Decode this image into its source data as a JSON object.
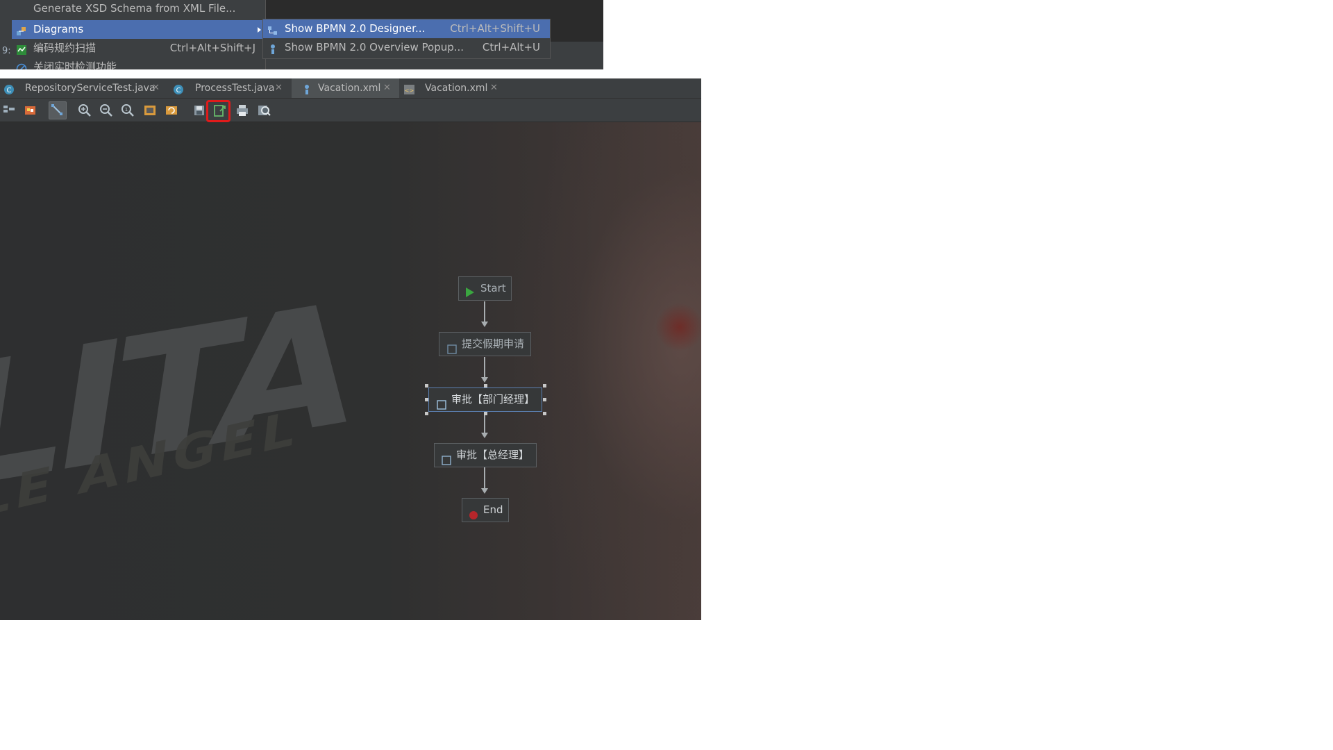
{
  "context_menu": {
    "gutter_char": "9:",
    "items": [
      {
        "label": "Generate XSD Schema from XML File...",
        "shortcut": "",
        "icon": "none"
      },
      {
        "label": "Diagrams",
        "shortcut": "",
        "icon": "diagrams-icon"
      },
      {
        "label": "编码规约扫描",
        "shortcut": "Ctrl+Alt+Shift+J",
        "icon": "scan-icon"
      },
      {
        "label": "关闭实时检测功能",
        "shortcut": "",
        "icon": "disable-icon"
      }
    ],
    "submenu": [
      {
        "label": "Show BPMN 2.0 Designer...",
        "shortcut": "Ctrl+Alt+Shift+U"
      },
      {
        "label": "Show BPMN 2.0 Overview Popup...",
        "shortcut": "Ctrl+Alt+U"
      }
    ]
  },
  "tabs": [
    {
      "label": "RepositoryServiceTest.java",
      "icon": "java-class-icon",
      "active": false
    },
    {
      "label": "ProcessTest.java",
      "icon": "java-class-icon",
      "active": false
    },
    {
      "label": "Vacation.xml",
      "icon": "bpmn-file-icon",
      "active": true
    },
    {
      "label": "Vacation.xml",
      "icon": "xml-file-icon",
      "active": false
    }
  ],
  "toolbar": {
    "buttons": [
      "structure-icon",
      "palette-icon",
      "select-tool-icon",
      "zoom-in-icon",
      "zoom-out-icon",
      "actual-size-icon",
      "fit-content-icon",
      "refresh-layout-icon",
      "save-icon",
      "export-image-icon",
      "print-icon",
      "preview-icon"
    ],
    "highlighted_button": "export-image-icon"
  },
  "background": {
    "title_text": "LITA",
    "subtitle_text": "LE ANGEL"
  },
  "diagram": {
    "nodes": [
      {
        "label": "Start",
        "type": "start-event"
      },
      {
        "label": "提交假期申请",
        "type": "user-task"
      },
      {
        "label": "审批【部门经理】",
        "type": "user-task",
        "selected": true
      },
      {
        "label": "审批【总经理】",
        "type": "user-task"
      },
      {
        "label": "End",
        "type": "end-event"
      }
    ]
  },
  "colors": {
    "menu_selection": "#4b6eaf",
    "highlight_box": "#e01b1b",
    "start_icon": "#3aa640",
    "end_icon": "#b5262b",
    "editor_bg": "#2b2b2b"
  }
}
